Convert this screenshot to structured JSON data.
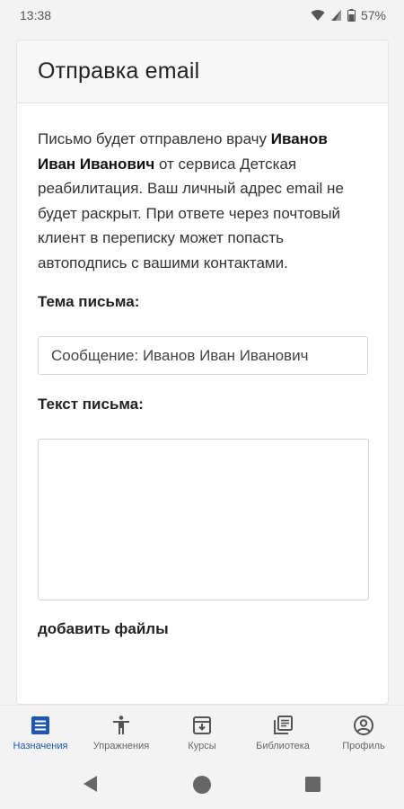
{
  "status_bar": {
    "time": "13:38",
    "battery": "57%"
  },
  "card": {
    "title": "Отправка email",
    "intro_part1": "Письмо будет отправлено врачу ",
    "doctor_name": "Иванов Иван Иванович",
    "intro_part2": " от сервиса Детская реабилитация. Ваш личный адрес email не будет раскрыт. При ответе через почтовый клиент в переписку может попасть автоподпись с вашими контактами.",
    "subject_label": "Тема письма:",
    "subject_value": "Сообщение: Иванов Иван Иванович",
    "body_label": "Текст письма:",
    "body_value": "",
    "add_files_label": "добавить файлы"
  },
  "bottom_nav": {
    "items": [
      {
        "label": "Назначения",
        "icon": "assignments-icon",
        "active": true
      },
      {
        "label": "Упражнения",
        "icon": "exercises-icon",
        "active": false
      },
      {
        "label": "Курсы",
        "icon": "courses-icon",
        "active": false
      },
      {
        "label": "Библиотека",
        "icon": "library-icon",
        "active": false
      },
      {
        "label": "Профиль",
        "icon": "profile-icon",
        "active": false
      }
    ]
  },
  "colors": {
    "accent": "#1e57b4",
    "inactive": "#666666"
  }
}
